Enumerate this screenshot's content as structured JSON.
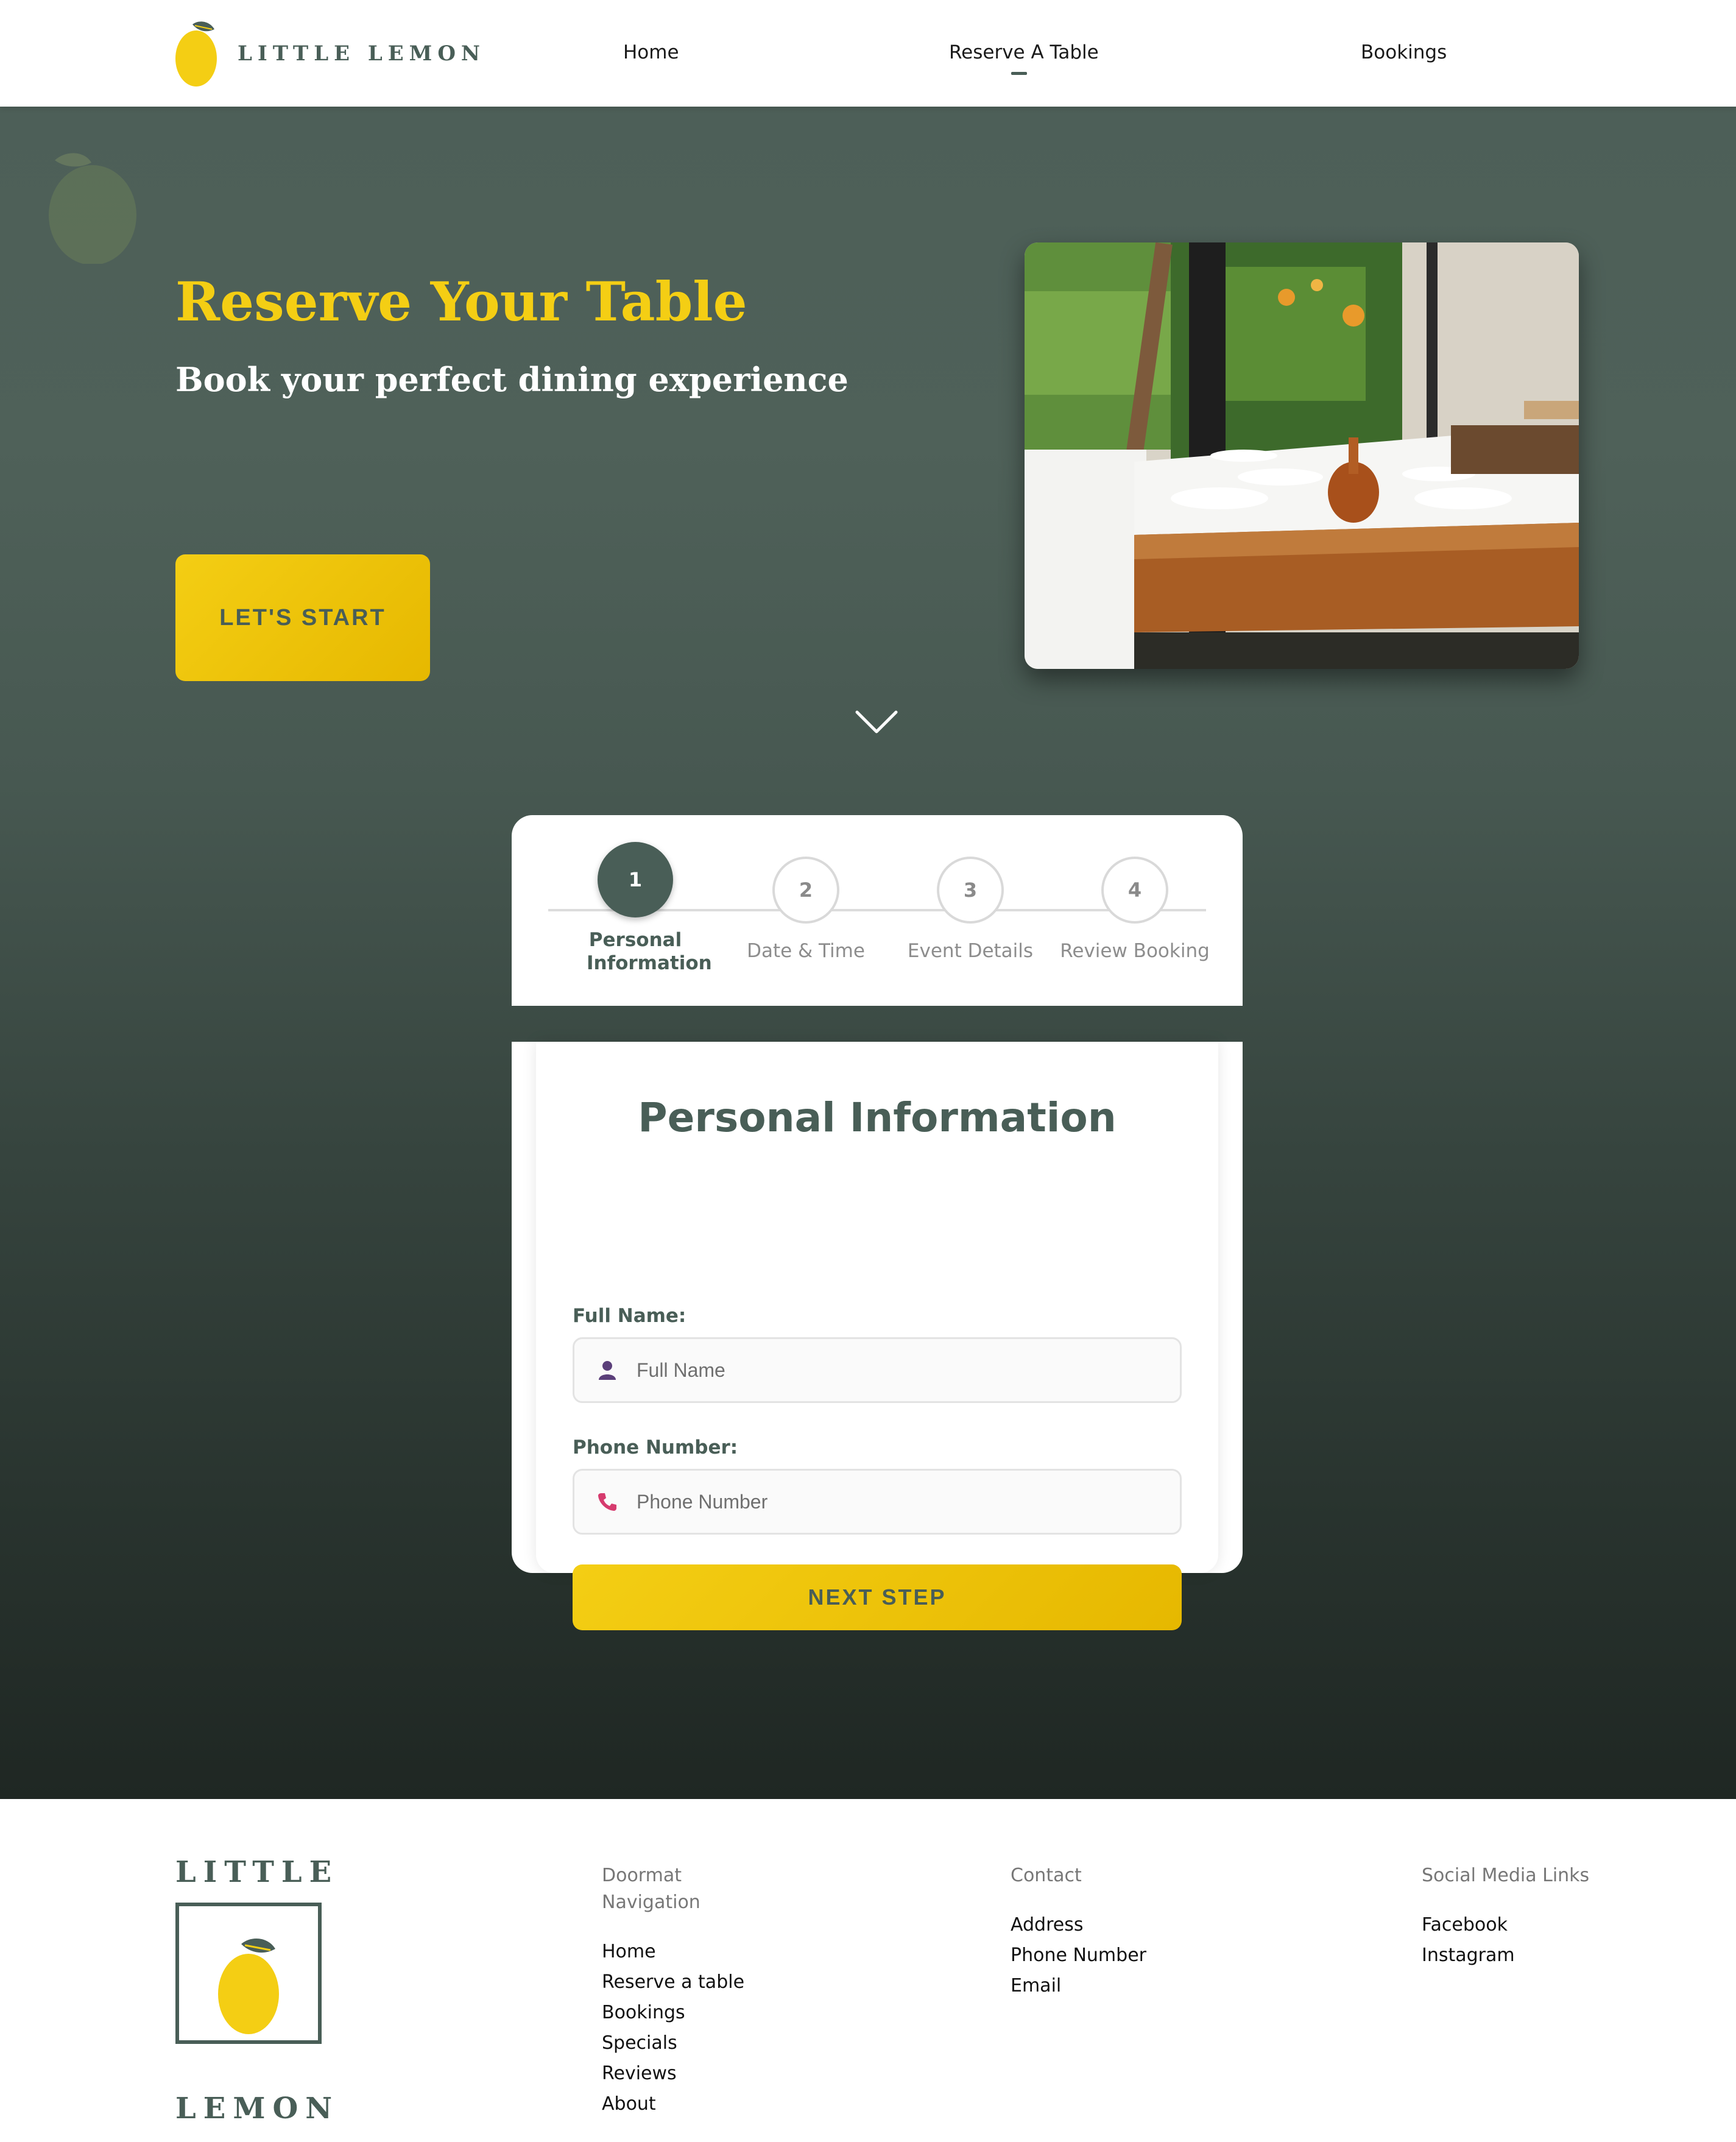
{
  "header": {
    "logo_text": "LITTLE LEMON",
    "nav": {
      "home": "Home",
      "reserve": "Reserve A Table",
      "bookings": "Bookings"
    }
  },
  "hero": {
    "title": "Reserve Your Table",
    "subtitle": "Book your perfect dining experience",
    "cta_label": "LET'S START"
  },
  "stepper": {
    "steps": [
      {
        "number": "1",
        "label": "Personal Information",
        "active": true
      },
      {
        "number": "2",
        "label": "Date & Time",
        "active": false
      },
      {
        "number": "3",
        "label": "Event Details",
        "active": false
      },
      {
        "number": "4",
        "label": "Review Booking",
        "active": false
      }
    ]
  },
  "form": {
    "title": "Personal Information",
    "full_name_label": "Full Name:",
    "full_name_placeholder": "Full Name",
    "full_name_value": "",
    "phone_label": "Phone Number:",
    "phone_placeholder": "Phone Number",
    "phone_value": "",
    "next_label": "NEXT STEP"
  },
  "footer": {
    "logo_top": "LITTLE",
    "logo_bottom": "LEMON",
    "nav_heading": "Doormat Navigation",
    "nav_links": [
      "Home",
      "Reserve a table",
      "Bookings",
      "Specials",
      "Reviews",
      "About"
    ],
    "contact_heading": "Contact",
    "contact_links": [
      "Address",
      "Phone Number",
      "Email"
    ],
    "social_heading": "Social Media Links",
    "social_links": [
      "Facebook",
      "Instagram"
    ]
  },
  "colors": {
    "brand_green": "#495E57",
    "brand_yellow": "#F4CE14"
  },
  "icons": {
    "user": "user-icon",
    "phone": "phone-icon",
    "chevron": "chevron-down-icon",
    "lemon": "lemon-logo-icon"
  }
}
